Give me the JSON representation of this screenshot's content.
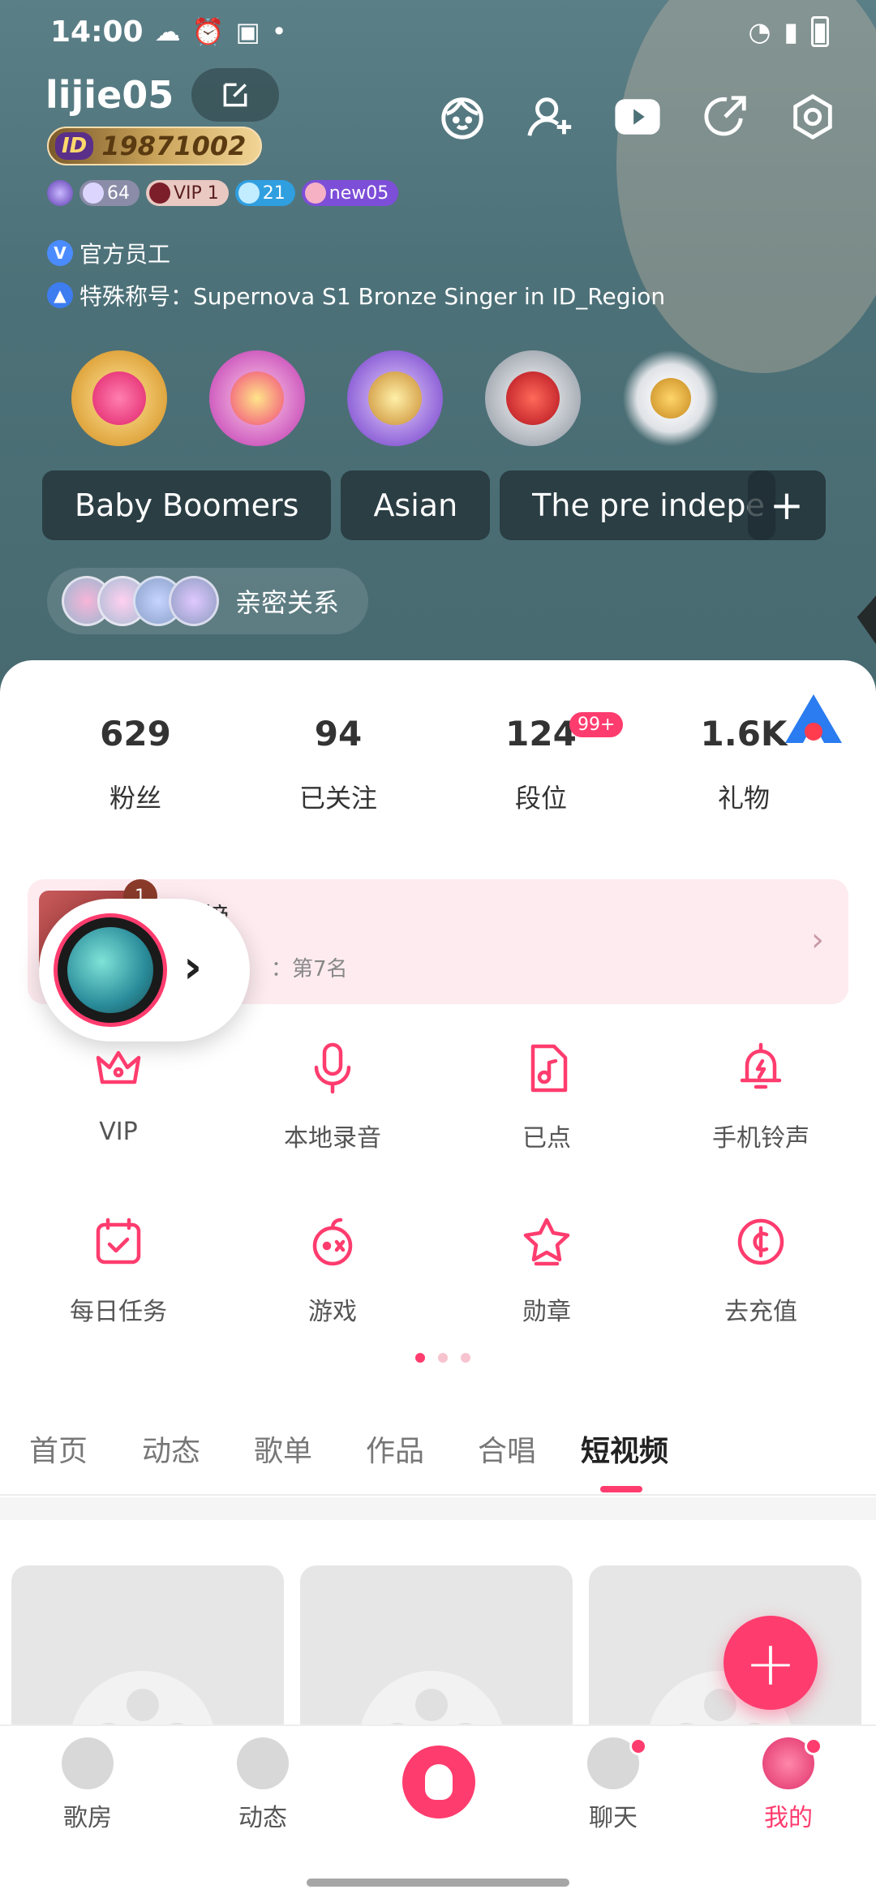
{
  "status_bar": {
    "time": "14:00"
  },
  "profile": {
    "username": "lijie05",
    "id_label": "ID",
    "id_number": "19871002",
    "levels": [
      {
        "text": ""
      },
      {
        "text": "64"
      },
      {
        "text": "VIP 1"
      },
      {
        "text": "21"
      },
      {
        "text": "new05"
      }
    ],
    "staff_icon": "V",
    "staff_label": "官方员工",
    "title_line": "特殊称号：Supernova S1 Bronze Singer in ID_Region",
    "tags": [
      "Baby Boomers",
      "Asian",
      "The pre indepe"
    ],
    "tag_add": "+",
    "intimacy_label": "亲密关系"
  },
  "stats": [
    {
      "value": "629",
      "label": "粉丝"
    },
    {
      "value": "94",
      "label": "已关注"
    },
    {
      "value": "124",
      "label": "段位",
      "badge": "99+"
    },
    {
      "value": "1.6K",
      "label": "礼物"
    }
  ],
  "rank_banner": {
    "badge": "1",
    "title": "…榜",
    "subtitle": "：第7名",
    "chevron": "›"
  },
  "floating_player": {
    "arrow": "›"
  },
  "grid_row1": [
    {
      "label": "VIP",
      "icon": "crown-icon"
    },
    {
      "label": "本地录音",
      "icon": "microphone-icon"
    },
    {
      "label": "已点",
      "icon": "music-note-icon"
    },
    {
      "label": "手机铃声",
      "icon": "bell-icon"
    }
  ],
  "grid_row2": [
    {
      "label": "每日任务",
      "icon": "calendar-check-icon"
    },
    {
      "label": "游戏",
      "icon": "gamepad-icon"
    },
    {
      "label": "勋章",
      "icon": "star-medal-icon"
    },
    {
      "label": "去充值",
      "icon": "coin-icon"
    }
  ],
  "tabs": [
    "首页",
    "动态",
    "歌单",
    "作品",
    "合唱",
    "短视频"
  ],
  "active_tab": "短视频",
  "fab_label": "+",
  "bottom_nav": [
    {
      "label": "歌房"
    },
    {
      "label": "动态"
    },
    {
      "label": ""
    },
    {
      "label": "聊天"
    },
    {
      "label": "我的"
    }
  ],
  "colors": {
    "accent": "#ff3c6e",
    "header": "#4d7178"
  }
}
